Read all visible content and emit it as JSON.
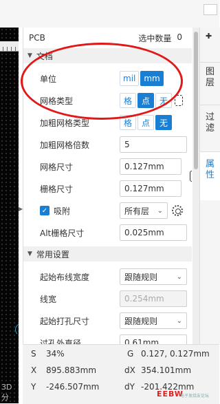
{
  "header": {
    "title": "PCB",
    "selected_label": "选中数量",
    "selected_count": "0"
  },
  "sections": {
    "document": "文档",
    "common": "常用设置"
  },
  "props": {
    "unit": {
      "label": "单位",
      "options": [
        "mil",
        "mm"
      ],
      "selected": "mm"
    },
    "grid_type": {
      "label": "网格类型",
      "options": [
        "格",
        "点",
        "无"
      ],
      "selected": "点"
    },
    "bold_grid_type": {
      "label": "加粗网格类型",
      "options": [
        "格",
        "点",
        "无"
      ],
      "selected": "无"
    },
    "bold_grid_multiple": {
      "label": "加粗网格倍数",
      "value": "5"
    },
    "grid_size": {
      "label": "网格尺寸",
      "value": "0.127mm"
    },
    "snap_grid_size": {
      "label": "栅格尺寸",
      "value": "0.127mm"
    },
    "snap": {
      "label": "吸附",
      "checked": true,
      "layer": "所有层"
    },
    "alt_grid": {
      "label": "Alt栅格尺寸",
      "value": "0.025mm"
    },
    "start_route_width": {
      "label": "起始布线宽度",
      "value": "跟随规则"
    },
    "line_width": {
      "label": "线宽",
      "value": "0.254mm"
    },
    "start_drill": {
      "label": "起始打孔尺寸",
      "value": "跟随规则"
    },
    "via_diameter": {
      "label": "过孔外直径",
      "value": "0.61mm"
    }
  },
  "tabs": [
    {
      "chars": [
        "图",
        "层"
      ]
    },
    {
      "chars": [
        "过",
        "滤"
      ]
    },
    {
      "chars": [
        "属",
        "性"
      ],
      "active": true
    }
  ],
  "status": {
    "s_label": "S",
    "s_value": "34%",
    "g_label": "G",
    "g_value": "0.127, 0.127mm",
    "x_label": "X",
    "x_value": "895.883mm",
    "dx_label": "dX",
    "dx_value": "354.101mm",
    "y_label": "Y",
    "y_value": "-246.507mm",
    "dy_label": "dY",
    "dy_value": "-201.422mm"
  },
  "canvas": {
    "label": "3D分"
  },
  "watermark": {
    "brand": "EEBW",
    "sub": "电子发烧友论坛"
  },
  "colors": {
    "accent": "#1a7fd3",
    "annotation": "#e01818"
  }
}
